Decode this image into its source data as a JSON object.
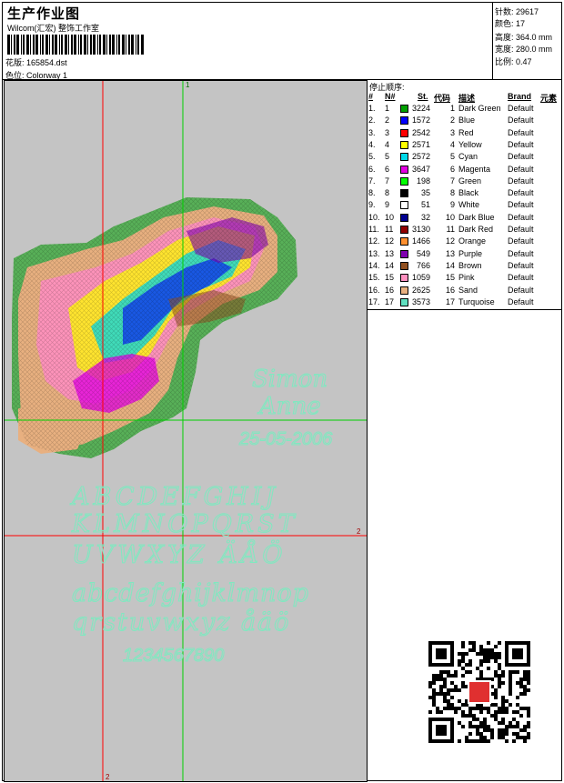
{
  "header": {
    "title": "生产作业图",
    "vendor": "Wilcom(汇宏) 整饰工作室",
    "design_label": "花版:",
    "design_file": "165854.dst",
    "colorway_label": "色位:",
    "colorway": "Colorway 1"
  },
  "stats": {
    "stitches_label": "针数:",
    "stitches": "29617",
    "colors_label": "颜色:",
    "colors": "17",
    "height_label": "高度:",
    "height": "364.0 mm",
    "width_label": "宽度:",
    "width": "280.0 mm",
    "scale_label": "比例:",
    "scale": "0.47"
  },
  "table": {
    "title": "停止顺序:",
    "headers": {
      "num": "#",
      "no": "N#",
      "st": "St.",
      "code": "代码",
      "desc": "描述",
      "brand": "Brand",
      "element": "元素"
    },
    "rows": [
      {
        "idx": "1.",
        "no": "1",
        "color": "#00a000",
        "st": "3224",
        "code": "1",
        "desc": "Dark Green",
        "brand": "Default"
      },
      {
        "idx": "2.",
        "no": "2",
        "color": "#0000ff",
        "st": "1572",
        "code": "2",
        "desc": "Blue",
        "brand": "Default"
      },
      {
        "idx": "3.",
        "no": "3",
        "color": "#ff0000",
        "st": "2542",
        "code": "3",
        "desc": "Red",
        "brand": "Default"
      },
      {
        "idx": "4.",
        "no": "4",
        "color": "#ffff00",
        "st": "2571",
        "code": "4",
        "desc": "Yellow",
        "brand": "Default"
      },
      {
        "idx": "5.",
        "no": "5",
        "color": "#00d8e8",
        "st": "2572",
        "code": "5",
        "desc": "Cyan",
        "brand": "Default"
      },
      {
        "idx": "6.",
        "no": "6",
        "color": "#e000e0",
        "st": "3647",
        "code": "6",
        "desc": "Magenta",
        "brand": "Default"
      },
      {
        "idx": "7.",
        "no": "7",
        "color": "#00ff00",
        "st": "198",
        "code": "7",
        "desc": "Green",
        "brand": "Default"
      },
      {
        "idx": "8.",
        "no": "8",
        "color": "#000000",
        "st": "35",
        "code": "8",
        "desc": "Black",
        "brand": "Default"
      },
      {
        "idx": "9.",
        "no": "9",
        "color": "#ffffff",
        "st": "51",
        "code": "9",
        "desc": "White",
        "brand": "Default"
      },
      {
        "idx": "10.",
        "no": "10",
        "color": "#000090",
        "st": "32",
        "code": "10",
        "desc": "Dark Blue",
        "brand": "Default"
      },
      {
        "idx": "11.",
        "no": "11",
        "color": "#900000",
        "st": "3130",
        "code": "11",
        "desc": "Dark Red",
        "brand": "Default"
      },
      {
        "idx": "12.",
        "no": "12",
        "color": "#ff9030",
        "st": "1466",
        "code": "12",
        "desc": "Orange",
        "brand": "Default"
      },
      {
        "idx": "13.",
        "no": "13",
        "color": "#8000b0",
        "st": "549",
        "code": "13",
        "desc": "Purple",
        "brand": "Default"
      },
      {
        "idx": "14.",
        "no": "14",
        "color": "#905020",
        "st": "766",
        "code": "14",
        "desc": "Brown",
        "brand": "Default"
      },
      {
        "idx": "15.",
        "no": "15",
        "color": "#ff90c0",
        "st": "1059",
        "code": "15",
        "desc": "Pink",
        "brand": "Default"
      },
      {
        "idx": "16.",
        "no": "16",
        "color": "#e8b080",
        "st": "2625",
        "code": "16",
        "desc": "Sand",
        "brand": "Default"
      },
      {
        "idx": "17.",
        "no": "17",
        "color": "#60e0c0",
        "st": "3573",
        "code": "17",
        "desc": "Turquoise",
        "brand": "Default"
      }
    ]
  },
  "canvas": {
    "guide_top": "1",
    "guide_right": "2",
    "guide_bottom": "2",
    "name1": "Simon",
    "name2": "Anne",
    "date": "25-05-2006",
    "alpha1": "ABCDEFGHIJ",
    "alpha2": "KLMNOPQRST",
    "alpha3": "UVWXYZ ÄÅÖ",
    "alpha4": "abcdefghijklmnop",
    "alpha5": "qrstuvwxyz åäö",
    "digits": "1234567890",
    "colors": {
      "guide_red": "#ff0000",
      "guide_green": "#00d000",
      "lettering": "#80e8c0",
      "background": "#c4c4c4"
    }
  }
}
